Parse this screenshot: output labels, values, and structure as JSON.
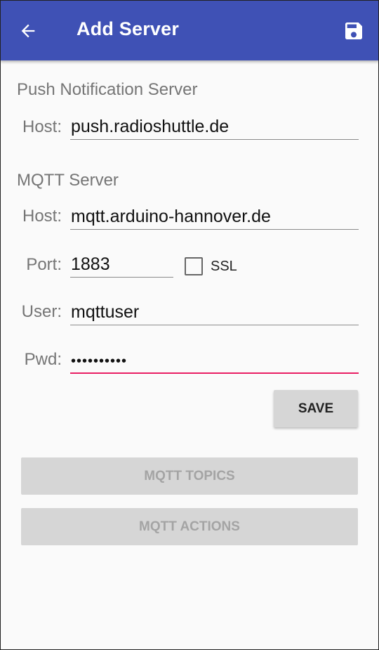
{
  "appbar": {
    "title": "Add Server",
    "back_icon": "arrow-back-icon",
    "save_icon": "floppy-save-icon",
    "color": "#3f51b5"
  },
  "push": {
    "section": "Push Notification Server",
    "host_label": "Host:",
    "host_value": "push.radioshuttle.de"
  },
  "mqtt": {
    "section": "MQTT Server",
    "host_label": "Host:",
    "host_value": "mqtt.arduino-hannover.de",
    "port_label": "Port:",
    "port_value": "1883",
    "ssl_label": "SSL",
    "ssl_checked": false,
    "user_label": "User:",
    "user_value": "mqttuser",
    "pwd_label": "Pwd:",
    "pwd_value": "••••••••••"
  },
  "buttons": {
    "save": "SAVE",
    "topics": "MQTT TOPICS",
    "actions": "MQTT ACTIONS"
  },
  "colors": {
    "accent": "#e91e63",
    "disabled_text": "#a4a4a4"
  }
}
